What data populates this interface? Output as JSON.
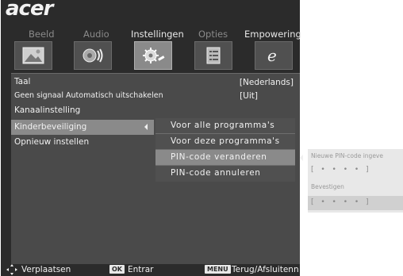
{
  "brand": "acer",
  "tabs": [
    {
      "label": "Beeld",
      "icon": "picture-icon"
    },
    {
      "label": "Audio",
      "icon": "speaker-icon"
    },
    {
      "label": "Instellingen",
      "icon": "settings-icon"
    },
    {
      "label": "Opties",
      "icon": "list-icon"
    },
    {
      "label": "Empowering",
      "icon": "e-icon"
    }
  ],
  "active_tab": "Instellingen",
  "settings": {
    "taal": {
      "label": "Taal",
      "value": "[Nederlands]"
    },
    "geen_signaal": {
      "label": "Geen signaal Automatisch uitschakelen",
      "value": "[Uit]"
    },
    "kanaalinstelling": {
      "label": "Kanaalinstelling"
    },
    "kinderbeveiliging": {
      "label": "Kinderbeveiliging"
    },
    "opnieuw": {
      "label": "Opnieuw instellen"
    }
  },
  "submenu": [
    {
      "label": "Voor alle programma's"
    },
    {
      "label": "Voor deze programma's"
    },
    {
      "label": "PIN-code veranderen"
    },
    {
      "label": "PIN-code annuleren"
    }
  ],
  "pin_panel": {
    "new_label": "Nieuwe PIN-code ingeve",
    "new_value": "[ • • • • ]",
    "confirm_label": "Bevestigen",
    "confirm_value": "[ • • • • ]"
  },
  "footer": {
    "move_label": "Verplaatsen",
    "ok_key": "OK",
    "enter_label": "Entrar",
    "menu_key": "MENU",
    "back_label": "Terug/Afsluitenn"
  }
}
